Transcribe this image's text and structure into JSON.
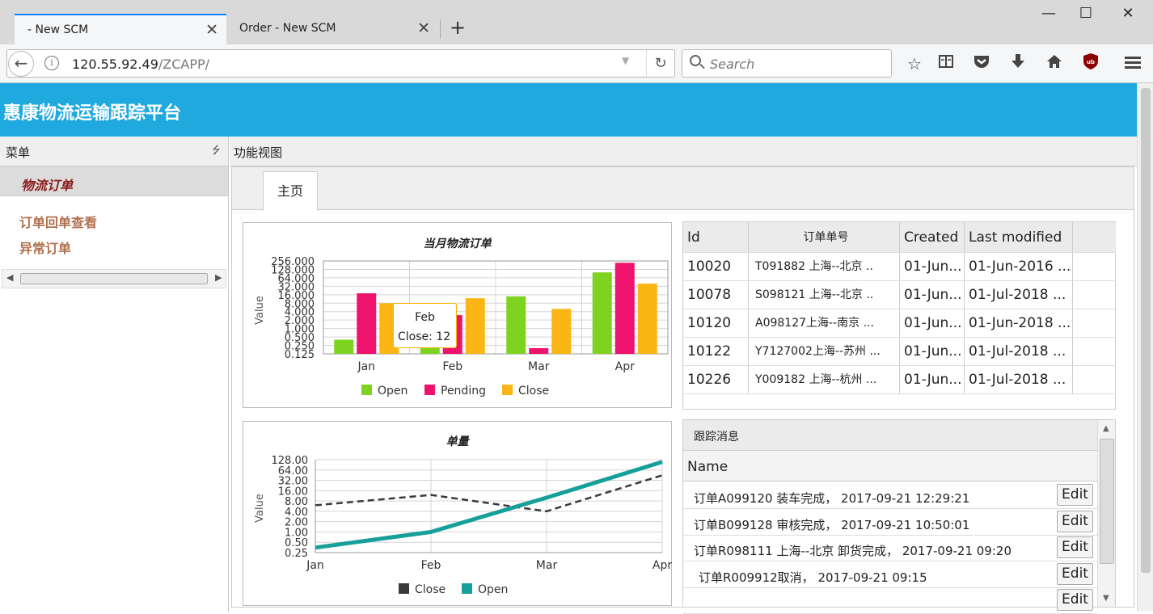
{
  "browser": {
    "tabs": [
      {
        "title": "- New SCM",
        "close": "✕"
      },
      {
        "title": "Order - New SCM",
        "close": "✕"
      }
    ],
    "new_tab": "+",
    "window_controls": {
      "minimize": "—",
      "maximize": "☐",
      "close": "✕"
    },
    "url_host": "120.55.92.49",
    "url_path": "/ZCAPP/",
    "search_placeholder": "Search",
    "toolbar_icons": [
      "bookmark-star-icon",
      "reading-list-icon",
      "pocket-icon",
      "download-icon",
      "home-icon",
      "ublock-icon",
      "hamburger-menu-icon"
    ]
  },
  "app": {
    "title": "惠康物流运输跟踪平台"
  },
  "menu": {
    "title": "菜单",
    "group": "物流订单",
    "items": [
      "订单回单查看",
      "异常订单"
    ]
  },
  "main": {
    "title": "功能视图",
    "tab": "主页"
  },
  "charts": {
    "bar_title": "当月物流订单",
    "bar_ylabel": "Value",
    "tooltip_title": "Feb",
    "tooltip_value": "Close: 12",
    "line_title": "单量",
    "line_ylabel": "Value"
  },
  "chart_data": [
    {
      "type": "bar",
      "title": "当月物流订单",
      "ylabel": "Value",
      "yscale": "log2",
      "ylim": [
        0.125,
        256
      ],
      "yticks": [
        "0.125",
        "0.250",
        "0.500",
        "1.000",
        "2.000",
        "4.000",
        "8.000",
        "16.000",
        "32.000",
        "64.000",
        "128.000",
        "256.000"
      ],
      "categories": [
        "Jan",
        "Feb",
        "Mar",
        "Apr"
      ],
      "series": [
        {
          "name": "Open",
          "color": "#7ed321",
          "values": [
            0.4,
            0.4,
            14,
            100
          ]
        },
        {
          "name": "Pending",
          "color": "#f0136e",
          "values": [
            18,
            3,
            0.2,
            220
          ]
        },
        {
          "name": "Close",
          "color": "#fbb514",
          "values": [
            8,
            12,
            5,
            40
          ]
        }
      ],
      "legend": "bottom"
    },
    {
      "type": "line",
      "title": "单量",
      "ylabel": "Value",
      "yscale": "log2",
      "ylim": [
        0.25,
        128
      ],
      "yticks": [
        "0.25",
        "0.50",
        "1.00",
        "2.00",
        "4.00",
        "8.00",
        "16.00",
        "32.00",
        "64.00",
        "128.00"
      ],
      "categories": [
        "Jan",
        "Feb",
        "Mar",
        "Apr"
      ],
      "series": [
        {
          "name": "Close",
          "color": "#3a3a3a",
          "style": "dashed",
          "values": [
            6,
            12,
            4,
            45
          ]
        },
        {
          "name": "Open",
          "color": "#17a09a",
          "style": "solid",
          "values": [
            0.35,
            1,
            10,
            110
          ]
        }
      ],
      "legend": "bottom"
    }
  ],
  "orders": {
    "headers": [
      "Id",
      "订单单号",
      "Created",
      "Last modified"
    ],
    "rows": [
      {
        "id": "10020",
        "no": "T091882 上海--北京     ..",
        "created": "01-Jun...",
        "modified": "01-Jun-2016 ..."
      },
      {
        "id": "10078",
        "no": "S098121 上海--北京     ..",
        "created": "01-Jun...",
        "modified": "01-Jul-2018 ..."
      },
      {
        "id": "10120",
        "no": "A098127上海--南京    ...",
        "created": "01-Jun...",
        "modified": "01-Jun-2018 ..."
      },
      {
        "id": "10122",
        "no": "Y7127002上海--苏州    ...",
        "created": "01-Jun...",
        "modified": "01-Jul-2018 ..."
      },
      {
        "id": "10226",
        "no": "Y009182 上海--杭州    ...",
        "created": "01-Jun...",
        "modified": "01-Jul-2018 ..."
      }
    ]
  },
  "tracking": {
    "title": "跟踪消息",
    "col_name": "Name",
    "edit_label": "Edit",
    "rows": [
      "订单A099120 装车完成， 2017-09-21 12:29:21",
      "订单B099128 审核完成， 2017-09-21 10:50:01",
      "订单R098111 上海--北京 卸货完成， 2017-09-21 09:20",
      "订单R009912取消， 2017-09-21 09:15",
      ""
    ]
  }
}
